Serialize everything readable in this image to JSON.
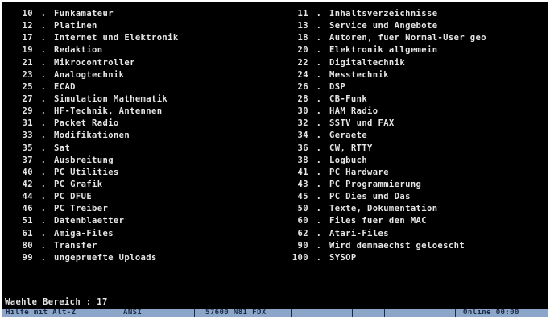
{
  "menu": {
    "left": [
      {
        "num": "10",
        "sep": ".",
        "label": "Funkamateur"
      },
      {
        "num": "12",
        "sep": ".",
        "label": "Platinen"
      },
      {
        "num": "17",
        "sep": ".",
        "label": "Internet und Elektronik"
      },
      {
        "num": "19",
        "sep": ".",
        "label": "Redaktion"
      },
      {
        "num": "21",
        "sep": ".",
        "label": "Mikrocontroller"
      },
      {
        "num": "23",
        "sep": ".",
        "label": "Analogtechnik"
      },
      {
        "num": "25",
        "sep": ".",
        "label": "ECAD"
      },
      {
        "num": "27",
        "sep": ".",
        "label": "Simulation Mathematik"
      },
      {
        "num": "29",
        "sep": ".",
        "label": "HF-Technik, Antennen"
      },
      {
        "num": "31",
        "sep": ".",
        "label": "Packet Radio"
      },
      {
        "num": "33",
        "sep": ".",
        "label": "Modifikationen"
      },
      {
        "num": "35",
        "sep": ".",
        "label": "Sat"
      },
      {
        "num": "37",
        "sep": ".",
        "label": "Ausbreitung"
      },
      {
        "num": "40",
        "sep": ".",
        "label": "PC Utilities"
      },
      {
        "num": "42",
        "sep": ".",
        "label": "PC Grafik"
      },
      {
        "num": "44",
        "sep": ".",
        "label": "PC DFUE"
      },
      {
        "num": "46",
        "sep": ".",
        "label": "PC Treiber"
      },
      {
        "num": "51",
        "sep": ".",
        "label": "Datenblaetter"
      },
      {
        "num": "61",
        "sep": ".",
        "label": "Amiga-Files"
      },
      {
        "num": "80",
        "sep": ".",
        "label": "Transfer"
      },
      {
        "num": "99",
        "sep": ".",
        "label": "ungepruefte Uploads"
      }
    ],
    "right": [
      {
        "num": "11",
        "sep": ".",
        "label": "Inhaltsverzeichnisse"
      },
      {
        "num": "13",
        "sep": ".",
        "label": "Service und Angebote"
      },
      {
        "num": "18",
        "sep": ".",
        "label": "Autoren, fuer Normal-User geo"
      },
      {
        "num": "20",
        "sep": ".",
        "label": "Elektronik allgemein"
      },
      {
        "num": "22",
        "sep": ".",
        "label": "Digitaltechnik"
      },
      {
        "num": "24",
        "sep": ".",
        "label": "Messtechnik"
      },
      {
        "num": "26",
        "sep": ".",
        "label": "DSP"
      },
      {
        "num": "28",
        "sep": ".",
        "label": "CB-Funk"
      },
      {
        "num": "30",
        "sep": ".",
        "label": "HAM Radio"
      },
      {
        "num": "32",
        "sep": ".",
        "label": "SSTV und FAX"
      },
      {
        "num": "34",
        "sep": ".",
        "label": "Geraete"
      },
      {
        "num": "36",
        "sep": ".",
        "label": "CW, RTTY"
      },
      {
        "num": "38",
        "sep": ".",
        "label": "Logbuch"
      },
      {
        "num": "41",
        "sep": ".",
        "label": "PC Hardware"
      },
      {
        "num": "43",
        "sep": ".",
        "label": "PC Programmierung"
      },
      {
        "num": "45",
        "sep": ".",
        "label": "PC Dies und Das"
      },
      {
        "num": "50",
        "sep": ".",
        "label": "Texte, Dokumentation"
      },
      {
        "num": "60",
        "sep": ".",
        "label": "Files fuer den MAC"
      },
      {
        "num": "62",
        "sep": ".",
        "label": "Atari-Files"
      },
      {
        "num": "90",
        "sep": ".",
        "label": "Wird demnaechst geloescht"
      },
      {
        "num": "100",
        "sep": ".",
        "label": "SYSOP"
      }
    ]
  },
  "prompt": {
    "text": "Waehle Bereich : 17"
  },
  "status_bar": {
    "help": "Hilfe mit Alt-Z",
    "emulation": "ANSI",
    "connection": "57600 N81 FDX",
    "mode": "Online 00:00"
  },
  "colors": {
    "screen_background": "#000000",
    "text": "#e6e6e6",
    "status_background": "#8ba6c8",
    "status_text": "#1c2a44"
  }
}
